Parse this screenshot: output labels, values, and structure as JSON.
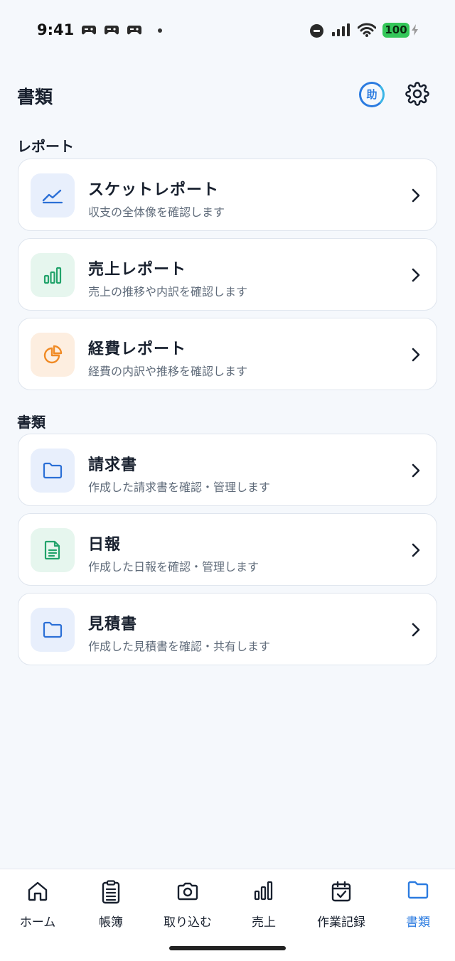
{
  "status": {
    "time": "9:41",
    "battery": "100"
  },
  "header": {
    "title": "書類",
    "assist_label": "助"
  },
  "sections": {
    "reports_title": "レポート",
    "docs_title": "書類"
  },
  "reports": [
    {
      "title": "スケットレポート",
      "subtitle": "収支の全体像を確認します",
      "icon": "line-chart-icon",
      "color": "#2b6fd6",
      "bg": "#e8effc"
    },
    {
      "title": "売上レポート",
      "subtitle": "売上の推移や内訳を確認します",
      "icon": "bar-chart-icon",
      "color": "#22a36b",
      "bg": "#e6f6ee"
    },
    {
      "title": "経費レポート",
      "subtitle": "経費の内訳や推移を確認します",
      "icon": "pie-chart-icon",
      "color": "#f08a24",
      "bg": "#fdeee0"
    }
  ],
  "documents": [
    {
      "title": "請求書",
      "subtitle": "作成した請求書を確認・管理します",
      "icon": "folder-icon",
      "color": "#2b6fd6",
      "bg": "#e8effc"
    },
    {
      "title": "日報",
      "subtitle": "作成した日報を確認・管理します",
      "icon": "document-icon",
      "color": "#22a36b",
      "bg": "#e6f6ee"
    },
    {
      "title": "見積書",
      "subtitle": "作成した見積書を確認・共有します",
      "icon": "folder-icon",
      "color": "#2b6fd6",
      "bg": "#e8effc"
    }
  ],
  "tabs": [
    {
      "label": "ホーム",
      "icon": "home-icon"
    },
    {
      "label": "帳簿",
      "icon": "clipboard-icon"
    },
    {
      "label": "取り込む",
      "icon": "camera-icon"
    },
    {
      "label": "売上",
      "icon": "bar-chart-icon"
    },
    {
      "label": "作業記録",
      "icon": "calendar-check-icon"
    },
    {
      "label": "書類",
      "icon": "folder-icon",
      "active": true
    }
  ],
  "colors": {
    "accent": "#2b7be0",
    "battery": "#34c759"
  }
}
